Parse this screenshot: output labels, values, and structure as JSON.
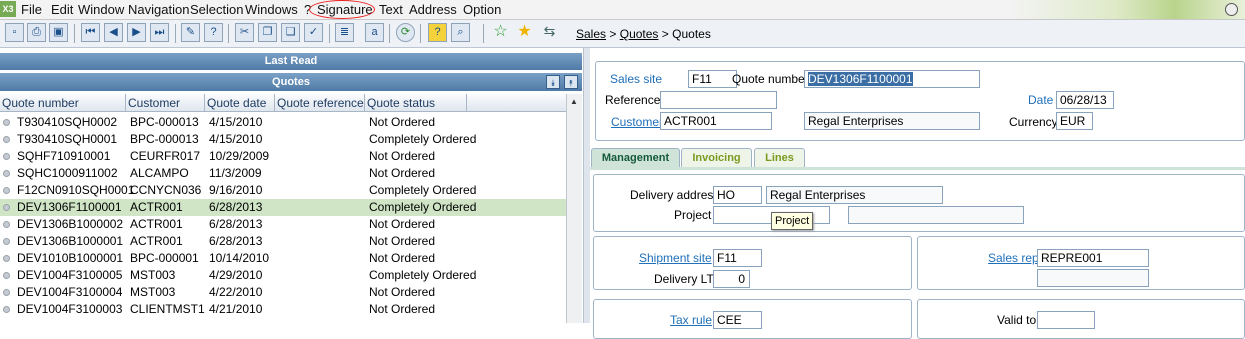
{
  "menu": {
    "logo_text": "X3",
    "items": [
      "File",
      "Edit",
      "Window",
      "Navigation",
      "Selection",
      "Windows",
      "?",
      "Signature",
      "Text",
      "Address",
      "Option"
    ]
  },
  "breadcrumb": {
    "parts": [
      "Sales",
      "Quotes",
      "Quotes"
    ],
    "separator": ">"
  },
  "left": {
    "last_read_title": "Last Read",
    "list_title": "Quotes",
    "columns": [
      "Quote number",
      "Customer",
      "Quote date",
      "Quote reference",
      "Quote status"
    ],
    "selected_index": 5,
    "rows": [
      {
        "quote_number": "T930410SQH0002",
        "customer": "BPC-000013",
        "quote_date": "4/15/2010",
        "quote_reference": "",
        "quote_status": "Not Ordered"
      },
      {
        "quote_number": "T930410SQH0001",
        "customer": "BPC-000013",
        "quote_date": "4/15/2010",
        "quote_reference": "",
        "quote_status": "Completely Ordered"
      },
      {
        "quote_number": "SQHF710910001",
        "customer": "CEURFR017",
        "quote_date": "10/29/2009",
        "quote_reference": "",
        "quote_status": "Not Ordered"
      },
      {
        "quote_number": "SQHC1000911002",
        "customer": "ALCAMPO",
        "quote_date": "11/3/2009",
        "quote_reference": "",
        "quote_status": "Not Ordered"
      },
      {
        "quote_number": "F12CN0910SQH0001",
        "customer": "CCNYCN036",
        "quote_date": "9/16/2010",
        "quote_reference": "",
        "quote_status": "Completely Ordered"
      },
      {
        "quote_number": "DEV1306F1100001",
        "customer": "ACTR001",
        "quote_date": "6/28/2013",
        "quote_reference": "",
        "quote_status": "Completely Ordered"
      },
      {
        "quote_number": "DEV1306B1000002",
        "customer": "ACTR001",
        "quote_date": "6/28/2013",
        "quote_reference": "",
        "quote_status": "Not Ordered"
      },
      {
        "quote_number": "DEV1306B1000001",
        "customer": "ACTR001",
        "quote_date": "6/28/2013",
        "quote_reference": "",
        "quote_status": "Not Ordered"
      },
      {
        "quote_number": "DEV1010B1000001",
        "customer": "BPC-000001",
        "quote_date": "10/14/2010",
        "quote_reference": "",
        "quote_status": "Not Ordered"
      },
      {
        "quote_number": "DEV1004F3100005",
        "customer": "MST003",
        "quote_date": "4/29/2010",
        "quote_reference": "",
        "quote_status": "Completely Ordered"
      },
      {
        "quote_number": "DEV1004F3100004",
        "customer": "MST003",
        "quote_date": "4/22/2010",
        "quote_reference": "",
        "quote_status": "Not Ordered"
      },
      {
        "quote_number": "DEV1004F3100003",
        "customer": "CLIENTMST1",
        "quote_date": "4/21/2010",
        "quote_reference": "",
        "quote_status": "Not Ordered"
      }
    ]
  },
  "header": {
    "sales_site_label": "Sales site",
    "sales_site_value": "F11",
    "quote_number_label": "Quote number",
    "quote_number_value": "DEV1306F1100001",
    "reference_label": "Reference",
    "reference_value": "",
    "date_label": "Date",
    "date_value": "06/28/13",
    "customer_label": "Customer",
    "customer_code": "ACTR001",
    "customer_name": "Regal Enterprises",
    "currency_label": "Currency",
    "currency_value": "EUR"
  },
  "tabs": [
    "Management",
    "Invoicing",
    "Lines"
  ],
  "management": {
    "delivery_address_label": "Delivery address",
    "delivery_address_code": "HO",
    "delivery_address_name": "Regal Enterprises",
    "project_label": "Project",
    "project_value": "",
    "project_desc": "",
    "tooltip": "Project",
    "shipment_site_label": "Shipment site",
    "shipment_site_value": "F11",
    "delivery_lt_label": "Delivery LT",
    "delivery_lt_value": "0",
    "sales_rep_label": "Sales rep",
    "sales_rep_value": "REPRE001",
    "sales_rep_desc": "",
    "tax_rule_label": "Tax rule",
    "tax_rule_value": "CEE",
    "valid_to_label": "Valid to",
    "valid_to_value": ""
  },
  "colors": {
    "header_bar": "#4f7aa6",
    "selected_row": "#cfe5c6",
    "link": "#1f6fb9",
    "signature_circle": "#e22222"
  },
  "icons": [
    "new-icon",
    "print-icon",
    "save-icon",
    "first-icon",
    "previous-icon",
    "next-icon",
    "last-icon",
    "edit-icon",
    "help-icon",
    "cut-icon",
    "copy-icon",
    "paste-icon",
    "validate-icon",
    "list-icon",
    "text-icon",
    "refresh-icon",
    "question-icon",
    "search-icon",
    "favorite-add-icon",
    "favorite-icon",
    "signpost-icon"
  ]
}
